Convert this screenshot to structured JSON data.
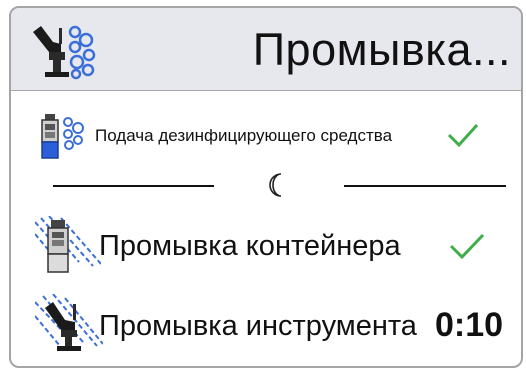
{
  "header": {
    "title": "Промывка...",
    "icon": "dental-chair-bubbles-icon"
  },
  "steps": [
    {
      "label": "Подача дезинфицирующего средства",
      "icon": "disinfectant-bottle-bubbles-icon",
      "status": "done",
      "status_icon": "checkmark-icon"
    },
    {
      "label": "Промывка контейнера",
      "icon": "container-rinse-icon",
      "status": "done",
      "status_icon": "checkmark-icon"
    },
    {
      "label": "Промывка инструмента",
      "icon": "instrument-rinse-icon",
      "status": "in_progress",
      "timer": "0:10"
    }
  ],
  "divider": {
    "icon": "moon-icon"
  },
  "colors": {
    "header_bg": "#e7e7ee",
    "check_green": "#3fae49",
    "bubble_blue": "#3a6fd8",
    "border": "#a5a5a5"
  }
}
